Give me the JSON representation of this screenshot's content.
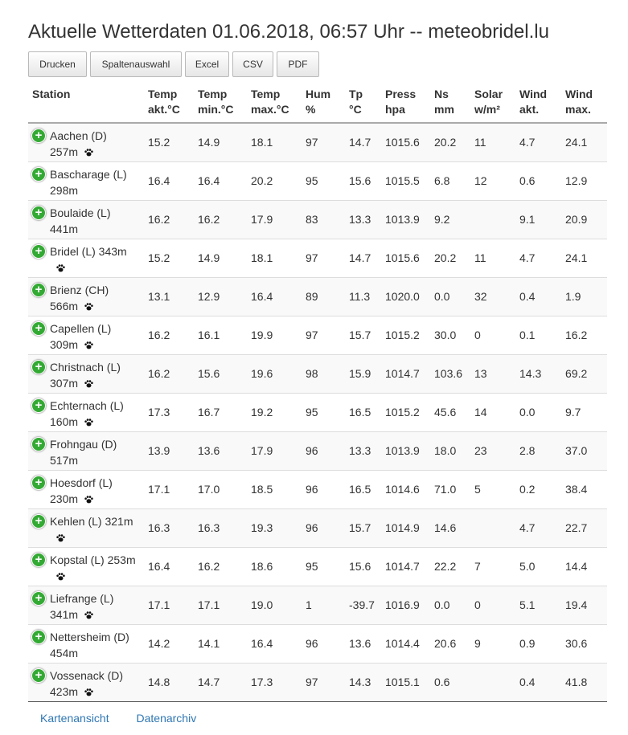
{
  "title": "Aktuelle Wetterdaten 01.06.2018, 06:57 Uhr -- meteobridel.lu",
  "buttons": [
    "Drucken",
    "Spaltenauswahl",
    "Excel",
    "CSV",
    "PDF"
  ],
  "columns": [
    {
      "l1": "Station",
      "l2": ""
    },
    {
      "l1": "Temp",
      "l2": "akt.°C"
    },
    {
      "l1": "Temp",
      "l2": "min.°C"
    },
    {
      "l1": "Temp",
      "l2": "max.°C"
    },
    {
      "l1": "Hum",
      "l2": "%"
    },
    {
      "l1": "Tp",
      "l2": "°C"
    },
    {
      "l1": "Press",
      "l2": "hpa"
    },
    {
      "l1": "Ns",
      "l2": "mm"
    },
    {
      "l1": "Solar",
      "l2": "w/m²"
    },
    {
      "l1": "Wind",
      "l2": "akt."
    },
    {
      "l1": "Wind",
      "l2": "max."
    }
  ],
  "rows": [
    {
      "l1": "Aachen (D)",
      "l2": "257m",
      "vals": [
        "15.2",
        "14.9",
        "18.1",
        "97",
        "14.7",
        "1015.6",
        "20.2",
        "11",
        "4.7",
        "24.1"
      ]
    },
    {
      "l1": "Bascharage (L)",
      "l2": "298m",
      "vals": [
        "16.4",
        "16.4",
        "20.2",
        "95",
        "15.6",
        "1015.5",
        "6.8",
        "12",
        "0.6",
        "12.9"
      ]
    },
    {
      "l1": "Boulaide (L)",
      "l2": "441m",
      "vals": [
        "16.2",
        "16.2",
        "17.9",
        "83",
        "13.3",
        "1013.9",
        "9.2",
        "",
        "9.1",
        "20.9"
      ]
    },
    {
      "l1": "Bridel (L) 343m",
      "l2": "",
      "vals": [
        "15.2",
        "14.9",
        "18.1",
        "97",
        "14.7",
        "1015.6",
        "20.2",
        "11",
        "4.7",
        "24.1"
      ]
    },
    {
      "l1": "Brienz (CH)",
      "l2": "566m",
      "vals": [
        "13.1",
        "12.9",
        "16.4",
        "89",
        "11.3",
        "1020.0",
        "0.0",
        "32",
        "0.4",
        "1.9"
      ]
    },
    {
      "l1": "Capellen (L)",
      "l2": "309m",
      "vals": [
        "16.2",
        "16.1",
        "19.9",
        "97",
        "15.7",
        "1015.2",
        "30.0",
        "0",
        "0.1",
        "16.2"
      ]
    },
    {
      "l1": "Christnach (L)",
      "l2": "307m",
      "vals": [
        "16.2",
        "15.6",
        "19.6",
        "98",
        "15.9",
        "1014.7",
        "103.6",
        "13",
        "14.3",
        "69.2"
      ]
    },
    {
      "l1": "Echternach (L)",
      "l2": "160m",
      "vals": [
        "17.3",
        "16.7",
        "19.2",
        "95",
        "16.5",
        "1015.2",
        "45.6",
        "14",
        "0.0",
        "9.7"
      ]
    },
    {
      "l1": "Frohngau (D)",
      "l2": "517m",
      "vals": [
        "13.9",
        "13.6",
        "17.9",
        "96",
        "13.3",
        "1013.9",
        "18.0",
        "23",
        "2.8",
        "37.0"
      ]
    },
    {
      "l1": "Hoesdorf (L)",
      "l2": "230m",
      "vals": [
        "17.1",
        "17.0",
        "18.5",
        "96",
        "16.5",
        "1014.6",
        "71.0",
        "5",
        "0.2",
        "38.4"
      ]
    },
    {
      "l1": "Kehlen (L) 321m",
      "l2": "",
      "vals": [
        "16.3",
        "16.3",
        "19.3",
        "96",
        "15.7",
        "1014.9",
        "14.6",
        "",
        "4.7",
        "22.7"
      ]
    },
    {
      "l1": "Kopstal (L) 253m",
      "l2": "",
      "vals": [
        "16.4",
        "16.2",
        "18.6",
        "95",
        "15.6",
        "1014.7",
        "22.2",
        "7",
        "5.0",
        "14.4"
      ]
    },
    {
      "l1": "Liefrange (L)",
      "l2": "341m",
      "vals": [
        "17.1",
        "17.1",
        "19.0",
        "1",
        "-39.7",
        "1016.9",
        "0.0",
        "0",
        "5.1",
        "19.4"
      ]
    },
    {
      "l1": "Nettersheim (D)",
      "l2": "454m",
      "vals": [
        "14.2",
        "14.1",
        "16.4",
        "96",
        "13.6",
        "1014.4",
        "20.6",
        "9",
        "0.9",
        "30.6"
      ]
    },
    {
      "l1": "Vossenack (D)",
      "l2": "423m",
      "vals": [
        "14.8",
        "14.7",
        "17.3",
        "97",
        "14.3",
        "1015.1",
        "0.6",
        "",
        "0.4",
        "41.8"
      ]
    }
  ],
  "paw_rows": [
    0,
    3,
    4,
    5,
    6,
    7,
    9,
    10,
    11,
    12,
    14
  ],
  "footer_links": [
    "Kartenansicht",
    "Datenarchiv"
  ],
  "colors": {
    "link": "#2f77b3",
    "expander": "#33aa33"
  }
}
